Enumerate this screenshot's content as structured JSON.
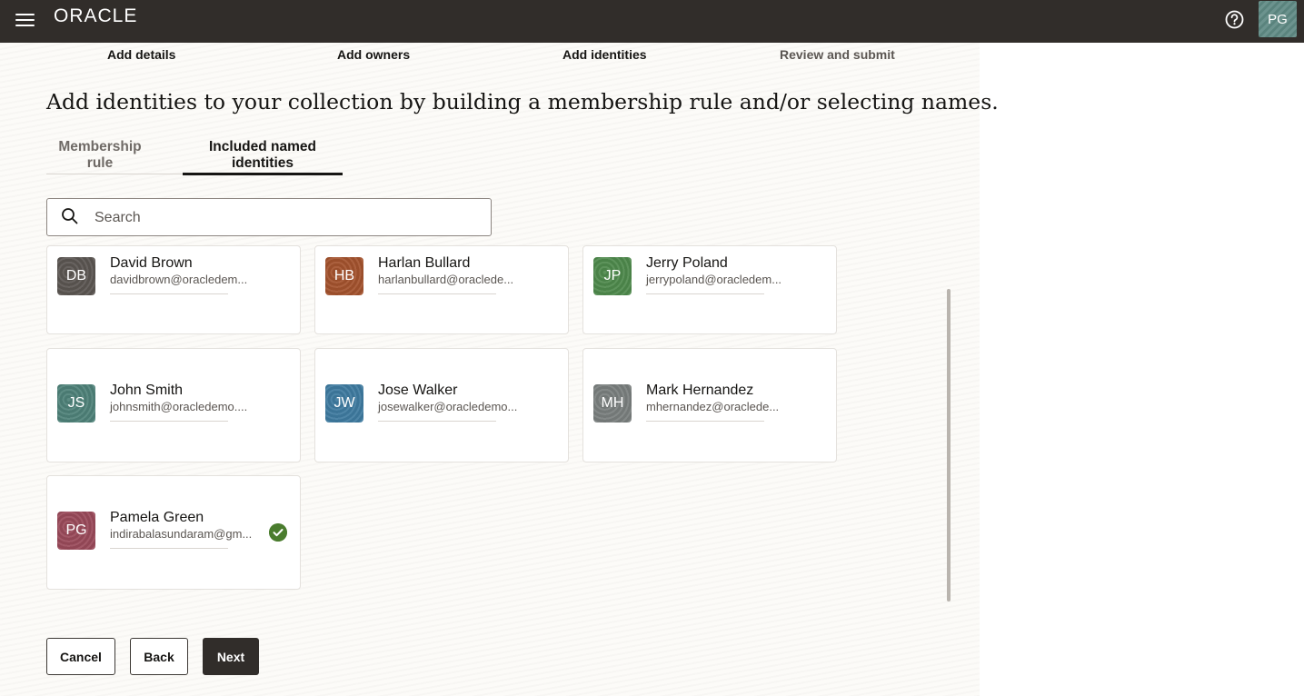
{
  "header": {
    "logo": "ORACLE",
    "user_initials": "PG",
    "icons": [
      "menu-icon",
      "help-icon"
    ]
  },
  "steps": [
    "Add details",
    "Add owners",
    "Add identities",
    "Review and submit"
  ],
  "heading": "Add identities to your collection by building a membership rule and/or selecting names.",
  "tabs": [
    {
      "label_line1": "Membership",
      "label_line2": "rule",
      "selected": false
    },
    {
      "label_line1": "Included named",
      "label_line2": "identities",
      "selected": true
    }
  ],
  "search": {
    "placeholder": "Search",
    "value": ""
  },
  "identities": [
    {
      "initials": "DB",
      "name": "David Brown",
      "email": "davidbrown@oracledem...",
      "color": "#5b5652",
      "selected": false
    },
    {
      "initials": "HB",
      "name": "Harlan Bullard",
      "email": "harlanbullard@oraclede...",
      "color": "#a4532e",
      "selected": false
    },
    {
      "initials": "JP",
      "name": "Jerry Poland",
      "email": "jerrypoland@oracledem...",
      "color": "#4f8a4d",
      "selected": false
    },
    {
      "initials": "JS",
      "name": "John Smith",
      "email": "johnsmith@oracledemo....",
      "color": "#4f8279",
      "selected": false
    },
    {
      "initials": "JW",
      "name": "Jose Walker",
      "email": "josewalker@oracledemo...",
      "color": "#3f7ba0",
      "selected": false
    },
    {
      "initials": "MH",
      "name": "Mark Hernandez",
      "email": "mhernandez@oraclede...",
      "color": "#7a7f7e",
      "selected": false
    },
    {
      "initials": "PG",
      "name": "Pamela Green",
      "email": "indirabalasundaram@gm...",
      "color": "#9a4a5a",
      "selected": true
    }
  ],
  "buttons": {
    "cancel": "Cancel",
    "back": "Back",
    "next": "Next"
  }
}
